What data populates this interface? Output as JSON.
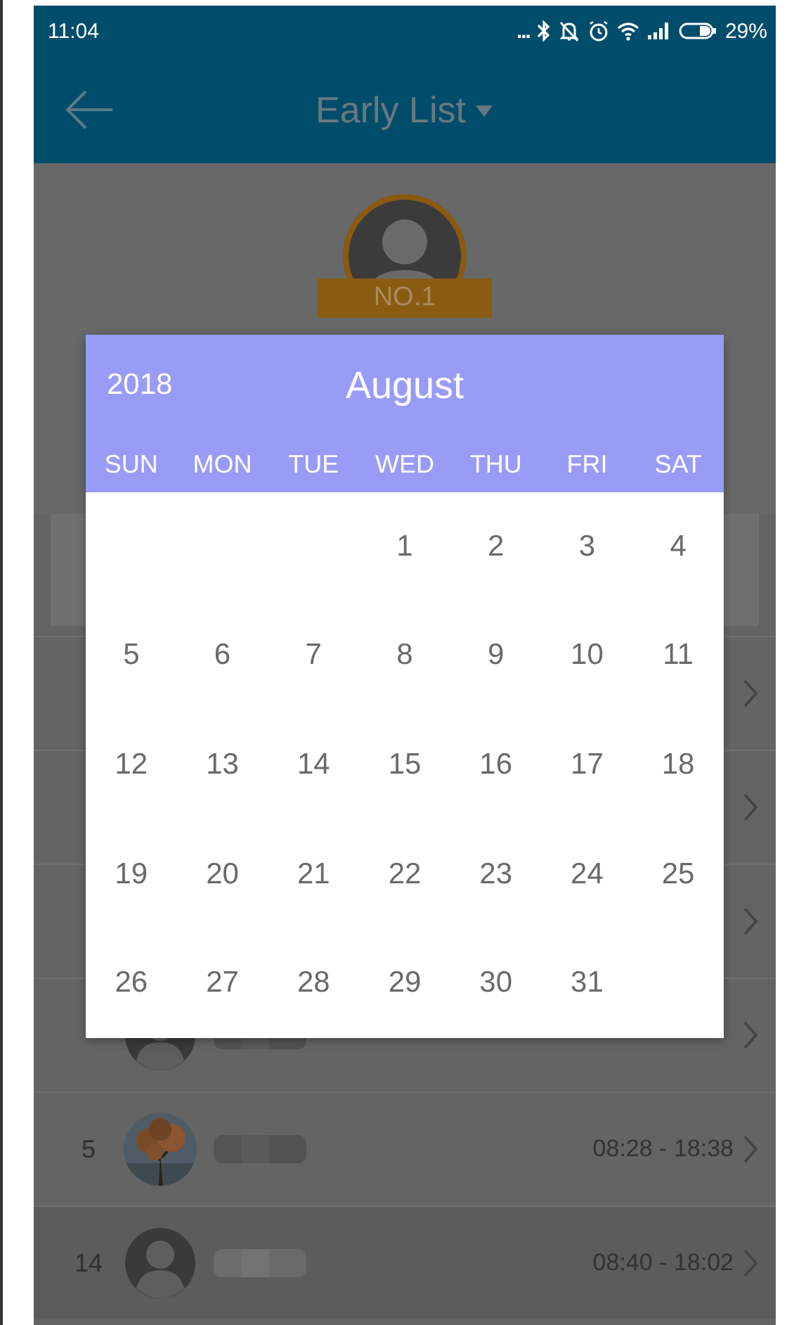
{
  "status_bar": {
    "time": "11:04",
    "more": "...",
    "battery": "29%"
  },
  "app_bar": {
    "title": "Early List"
  },
  "leader": {
    "badge": "NO.1"
  },
  "rows": [
    {
      "kind": "covered"
    },
    {
      "kind": "covered"
    },
    {
      "kind": "covered"
    },
    {
      "kind": "partial",
      "avatar": {
        "kind": "silhouette"
      },
      "name_blurred": true
    },
    {
      "kind": "entry",
      "rank": "5",
      "name_blurred": true,
      "time": "08:28 - 18:38",
      "selected": false
    },
    {
      "kind": "entry",
      "rank": "14",
      "avatar": {
        "kind": "silhouette"
      },
      "name_blurred": true,
      "time": "08:40 - 18:02",
      "selected": true
    }
  ],
  "date_picker": {
    "year": "2018",
    "month": "August",
    "weekdays": [
      "SUN",
      "MON",
      "TUE",
      "WED",
      "THU",
      "FRI",
      "SAT"
    ],
    "weeks": [
      [
        "1",
        "2",
        "3",
        "4"
      ],
      [
        "5",
        "6",
        "7",
        "8",
        "9",
        "10",
        "11"
      ],
      [
        "12",
        "13",
        "14",
        "15",
        "16",
        "17",
        "18"
      ],
      [
        "19",
        "20",
        "21",
        "22",
        "23",
        "24",
        "25"
      ],
      [
        "26",
        "27",
        "28",
        "29",
        "30",
        "31"
      ]
    ]
  }
}
